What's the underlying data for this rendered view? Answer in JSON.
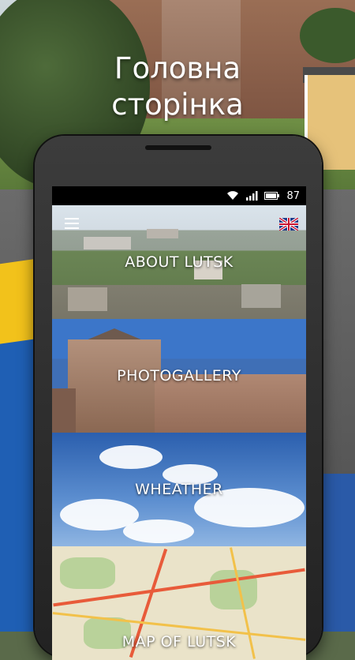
{
  "headline": "Головна\nсторінка",
  "status_bar": {
    "battery": "87",
    "icons": [
      "wifi-icon",
      "signal-icon",
      "battery-icon"
    ]
  },
  "toolbar": {
    "menu_icon": "hamburger-menu-icon",
    "language_icon": "uk-flag-icon"
  },
  "tiles": [
    {
      "label": "ABOUT LUTSK"
    },
    {
      "label": "PHOTOGALLERY"
    },
    {
      "label": "WHEATHER"
    },
    {
      "label": "MAP OF LUTSK"
    }
  ]
}
